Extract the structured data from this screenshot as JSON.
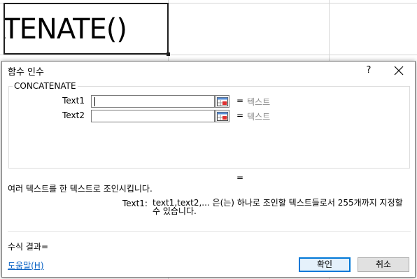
{
  "sheet": {
    "cell_text": "ATENATE()"
  },
  "dialog": {
    "title": "함수 인수",
    "help_label": "?",
    "close_label": "✕",
    "function_name": "CONCATENATE",
    "args": [
      {
        "label": "Text1",
        "value": "",
        "equals": "=",
        "hint": "텍스트"
      },
      {
        "label": "Text2",
        "value": "",
        "equals": "=",
        "hint": "텍스트"
      }
    ],
    "result_equals": "=",
    "function_description": "여러 텍스트를 한 텍스트로 조인시킵니다.",
    "arg_description_name": "Text1:",
    "arg_description_text": "text1,text2,... 은(는) 하나로 조인할 텍스트들로서 255개까지 지정할 수 있습니다.",
    "formula_result": "수식 결과=",
    "help_link": "도움말(H)",
    "ok_label": "확인",
    "cancel_label": "취소",
    "ref_icon": "range-select-icon",
    "accent_color": "#0078d7",
    "link_color": "#0b63c5"
  }
}
